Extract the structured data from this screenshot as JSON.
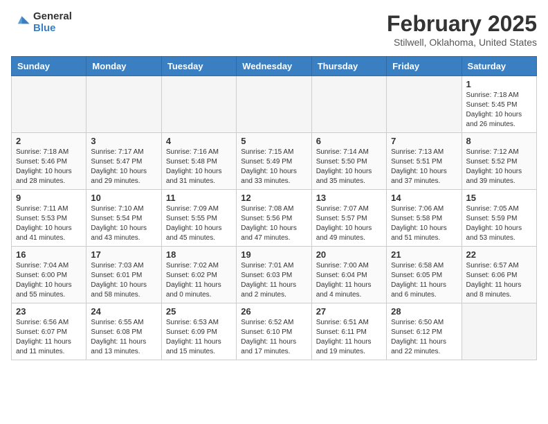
{
  "logo": {
    "general": "General",
    "blue": "Blue"
  },
  "header": {
    "month": "February 2025",
    "location": "Stilwell, Oklahoma, United States"
  },
  "days_of_week": [
    "Sunday",
    "Monday",
    "Tuesday",
    "Wednesday",
    "Thursday",
    "Friday",
    "Saturday"
  ],
  "weeks": [
    [
      {
        "day": "",
        "empty": true
      },
      {
        "day": "",
        "empty": true
      },
      {
        "day": "",
        "empty": true
      },
      {
        "day": "",
        "empty": true
      },
      {
        "day": "",
        "empty": true
      },
      {
        "day": "",
        "empty": true
      },
      {
        "day": "1",
        "sunrise": "7:18 AM",
        "sunset": "5:45 PM",
        "daylight": "10 hours and 26 minutes."
      }
    ],
    [
      {
        "day": "2",
        "sunrise": "7:18 AM",
        "sunset": "5:46 PM",
        "daylight": "10 hours and 28 minutes."
      },
      {
        "day": "3",
        "sunrise": "7:17 AM",
        "sunset": "5:47 PM",
        "daylight": "10 hours and 29 minutes."
      },
      {
        "day": "4",
        "sunrise": "7:16 AM",
        "sunset": "5:48 PM",
        "daylight": "10 hours and 31 minutes."
      },
      {
        "day": "5",
        "sunrise": "7:15 AM",
        "sunset": "5:49 PM",
        "daylight": "10 hours and 33 minutes."
      },
      {
        "day": "6",
        "sunrise": "7:14 AM",
        "sunset": "5:50 PM",
        "daylight": "10 hours and 35 minutes."
      },
      {
        "day": "7",
        "sunrise": "7:13 AM",
        "sunset": "5:51 PM",
        "daylight": "10 hours and 37 minutes."
      },
      {
        "day": "8",
        "sunrise": "7:12 AM",
        "sunset": "5:52 PM",
        "daylight": "10 hours and 39 minutes."
      }
    ],
    [
      {
        "day": "9",
        "sunrise": "7:11 AM",
        "sunset": "5:53 PM",
        "daylight": "10 hours and 41 minutes."
      },
      {
        "day": "10",
        "sunrise": "7:10 AM",
        "sunset": "5:54 PM",
        "daylight": "10 hours and 43 minutes."
      },
      {
        "day": "11",
        "sunrise": "7:09 AM",
        "sunset": "5:55 PM",
        "daylight": "10 hours and 45 minutes."
      },
      {
        "day": "12",
        "sunrise": "7:08 AM",
        "sunset": "5:56 PM",
        "daylight": "10 hours and 47 minutes."
      },
      {
        "day": "13",
        "sunrise": "7:07 AM",
        "sunset": "5:57 PM",
        "daylight": "10 hours and 49 minutes."
      },
      {
        "day": "14",
        "sunrise": "7:06 AM",
        "sunset": "5:58 PM",
        "daylight": "10 hours and 51 minutes."
      },
      {
        "day": "15",
        "sunrise": "7:05 AM",
        "sunset": "5:59 PM",
        "daylight": "10 hours and 53 minutes."
      }
    ],
    [
      {
        "day": "16",
        "sunrise": "7:04 AM",
        "sunset": "6:00 PM",
        "daylight": "10 hours and 55 minutes."
      },
      {
        "day": "17",
        "sunrise": "7:03 AM",
        "sunset": "6:01 PM",
        "daylight": "10 hours and 58 minutes."
      },
      {
        "day": "18",
        "sunrise": "7:02 AM",
        "sunset": "6:02 PM",
        "daylight": "11 hours and 0 minutes."
      },
      {
        "day": "19",
        "sunrise": "7:01 AM",
        "sunset": "6:03 PM",
        "daylight": "11 hours and 2 minutes."
      },
      {
        "day": "20",
        "sunrise": "7:00 AM",
        "sunset": "6:04 PM",
        "daylight": "11 hours and 4 minutes."
      },
      {
        "day": "21",
        "sunrise": "6:58 AM",
        "sunset": "6:05 PM",
        "daylight": "11 hours and 6 minutes."
      },
      {
        "day": "22",
        "sunrise": "6:57 AM",
        "sunset": "6:06 PM",
        "daylight": "11 hours and 8 minutes."
      }
    ],
    [
      {
        "day": "23",
        "sunrise": "6:56 AM",
        "sunset": "6:07 PM",
        "daylight": "11 hours and 11 minutes."
      },
      {
        "day": "24",
        "sunrise": "6:55 AM",
        "sunset": "6:08 PM",
        "daylight": "11 hours and 13 minutes."
      },
      {
        "day": "25",
        "sunrise": "6:53 AM",
        "sunset": "6:09 PM",
        "daylight": "11 hours and 15 minutes."
      },
      {
        "day": "26",
        "sunrise": "6:52 AM",
        "sunset": "6:10 PM",
        "daylight": "11 hours and 17 minutes."
      },
      {
        "day": "27",
        "sunrise": "6:51 AM",
        "sunset": "6:11 PM",
        "daylight": "11 hours and 19 minutes."
      },
      {
        "day": "28",
        "sunrise": "6:50 AM",
        "sunset": "6:12 PM",
        "daylight": "11 hours and 22 minutes."
      },
      {
        "day": "",
        "empty": true
      }
    ]
  ]
}
